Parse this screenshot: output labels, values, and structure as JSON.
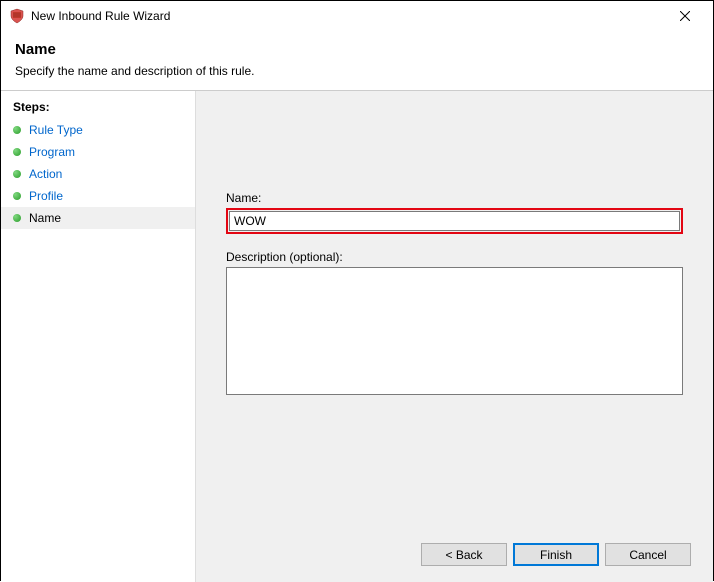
{
  "window": {
    "title": "New Inbound Rule Wizard"
  },
  "header": {
    "title": "Name",
    "subtitle": "Specify the name and description of this rule."
  },
  "sidebar": {
    "header": "Steps:",
    "items": [
      {
        "label": "Rule Type"
      },
      {
        "label": "Program"
      },
      {
        "label": "Action"
      },
      {
        "label": "Profile"
      },
      {
        "label": "Name"
      }
    ]
  },
  "form": {
    "name_label": "Name:",
    "name_value": "WOW",
    "desc_label": "Description (optional):",
    "desc_value": ""
  },
  "buttons": {
    "back": "< Back",
    "finish": "Finish",
    "cancel": "Cancel"
  }
}
